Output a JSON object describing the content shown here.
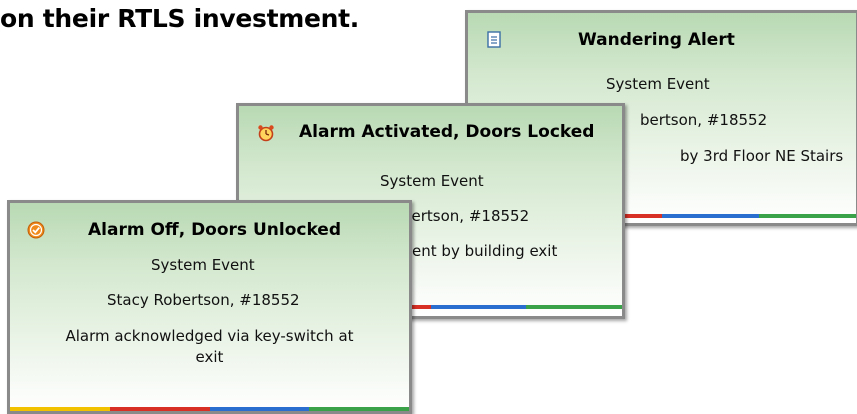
{
  "headline": "on their RTLS investment.",
  "cards": [
    {
      "title": "Wandering Alert",
      "type": "System Event",
      "person": "bertson, #18552",
      "message": "by 3rd Floor NE Stairs",
      "icon": "document-icon"
    },
    {
      "title": "Alarm Activated, Doors Locked",
      "type": "System Event",
      "person": "bertson, #18552",
      "message": "tient by building exit",
      "icon": "alarm-clock-icon"
    },
    {
      "title": "Alarm Off, Doors Unlocked",
      "type": "System Event",
      "person": "Stacy Robertson, #18552",
      "message_line1": "Alarm acknowledged via key-switch at",
      "message_line2": "exit",
      "icon": "check-circle-icon"
    }
  ],
  "stripe_colors": [
    "#f2c200",
    "#d93025",
    "#2a6fcf",
    "#3aa34a"
  ]
}
